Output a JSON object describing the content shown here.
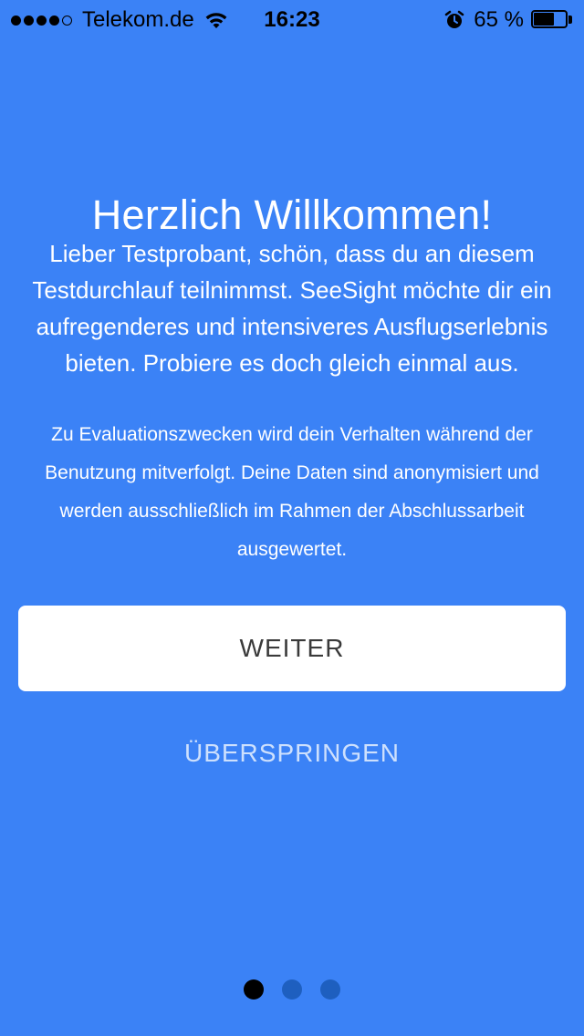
{
  "status_bar": {
    "carrier": "Telekom.de",
    "time": "16:23",
    "battery_percent_label": "65 %",
    "battery_level": 0.65,
    "signal_bars_filled": 4,
    "signal_bars_total": 5,
    "icons": [
      "wifi-icon",
      "alarm-icon",
      "battery-icon"
    ]
  },
  "onboarding": {
    "title": "Herzlich Willkommen!",
    "intro": "Lieber Testprobant, schön, dass du an diesem Testdurchlauf teilnimmst. SeeSight möchte dir ein aufregenderes und intensiveres Ausflugserlebnis bieten. Probiere es doch gleich einmal aus.",
    "notice": "Zu Evaluationszwecken wird dein Verhalten während der Benutzung mitverfolgt. Deine Daten sind anonymisiert und werden ausschließlich im Rahmen der Abschlussarbeit ausgewertet.",
    "continue_label": "WEITER",
    "skip_label": "ÜBERSPRINGEN"
  },
  "pagination": {
    "total": 3,
    "current": 1
  },
  "colors": {
    "background": "#3b82f6",
    "button_bg": "#ffffff",
    "button_text": "#3a3a3a",
    "dot_inactive": "#1e5fbf",
    "dot_active": "#000000"
  }
}
